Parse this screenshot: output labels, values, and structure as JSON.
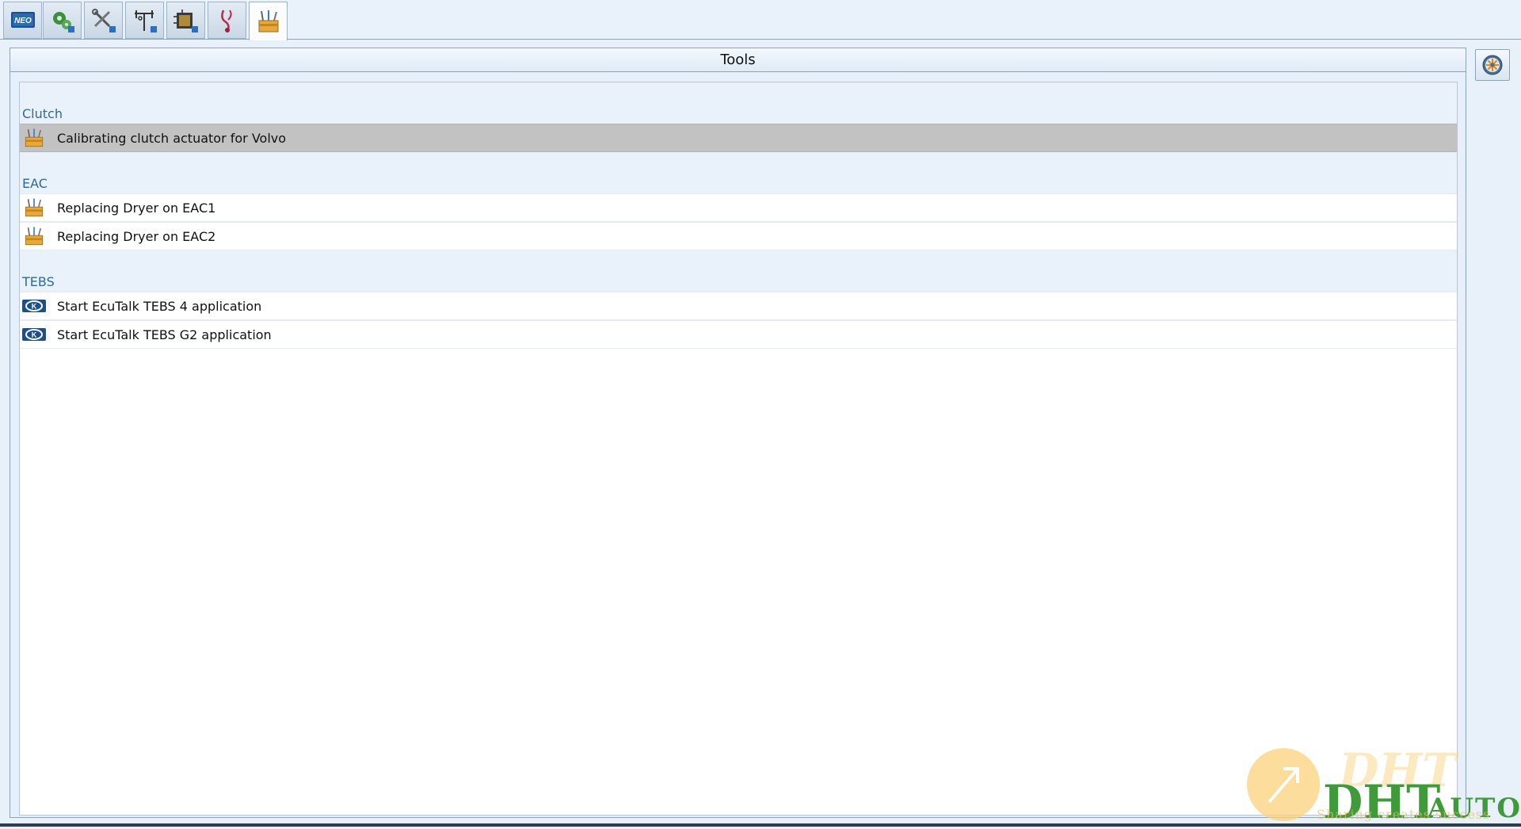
{
  "toolbar": {
    "tabs": [
      {
        "name": "neo-logo-tab",
        "icon": "neo-logo-icon"
      },
      {
        "name": "gear-diagnostics-tab",
        "icon": "gears-icon"
      },
      {
        "name": "wrench-service-tab",
        "icon": "wrench-screwdriver-icon"
      },
      {
        "name": "axle-config-tab",
        "icon": "axle-icon"
      },
      {
        "name": "ecu-tab",
        "icon": "ecu-chip-icon"
      },
      {
        "name": "stethoscope-tab",
        "icon": "stethoscope-icon"
      },
      {
        "name": "tools-tab",
        "icon": "toolbox-icon",
        "active": true
      }
    ],
    "neo_text": "NEO"
  },
  "panel": {
    "title": "Tools"
  },
  "groups": [
    {
      "label": "Clutch",
      "items": [
        {
          "label": "Calibrating clutch actuator for Volvo",
          "icon": "toolbox-icon",
          "selected": true
        }
      ]
    },
    {
      "label": "EAC",
      "items": [
        {
          "label": "Replacing Dryer on EAC1",
          "icon": "toolbox-icon"
        },
        {
          "label": "Replacing Dryer on EAC2",
          "icon": "toolbox-icon"
        }
      ]
    },
    {
      "label": "TEBS",
      "items": [
        {
          "label": "Start EcuTalk TEBS 4 application",
          "icon": "knorr-logo-icon"
        },
        {
          "label": "Start EcuTalk TEBS G2 application",
          "icon": "knorr-logo-icon"
        }
      ]
    }
  ],
  "side_button": {
    "icon": "settings-wheel-icon"
  },
  "watermark": {
    "brand_main": "DHT",
    "brand_suffix": "AUTO",
    "slogan": "Sharing creates success"
  },
  "colors": {
    "background": "#e8f1fa",
    "group_label": "#2f6b9a",
    "selected_row": "#c2c2c2"
  }
}
